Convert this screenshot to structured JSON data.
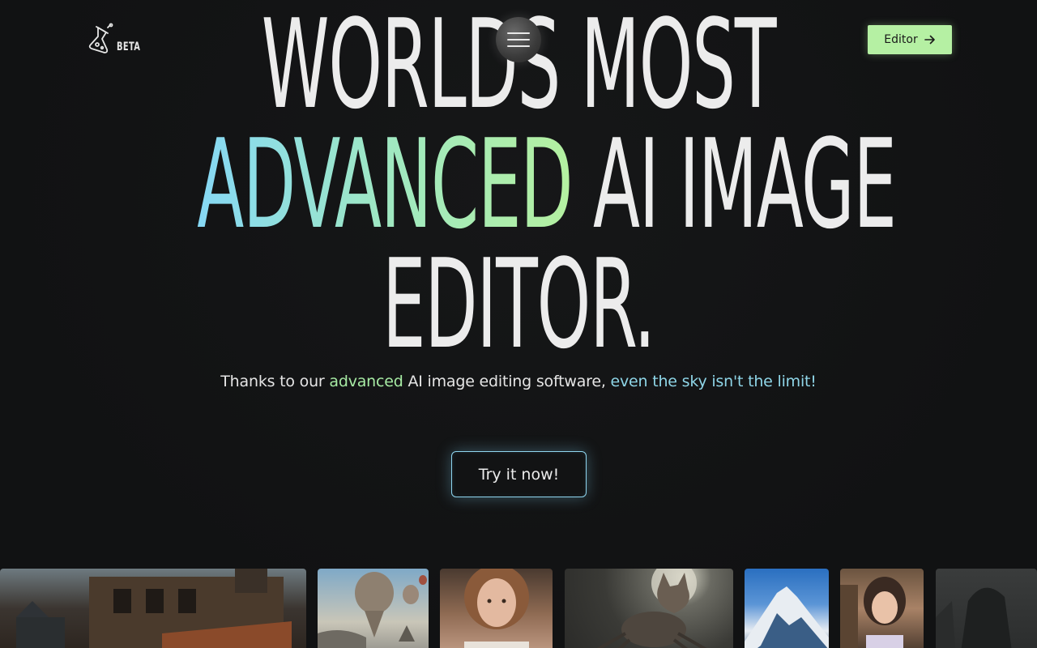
{
  "header": {
    "logo_badge": "BETA",
    "menu_icon": "hamburger-icon",
    "editor_label": "Editor",
    "editor_icon": "arrow-right-icon"
  },
  "hero": {
    "line1": "WORLDS MOST",
    "line2_highlight": "ADVANCED",
    "line2_rest": " AI IMAGE",
    "line3": "EDITOR.",
    "subtitle": {
      "part1": "Thanks to our ",
      "highlight1": "advanced",
      "part2": " AI image editing software, ",
      "highlight2": "even the sky isn't the limit!"
    },
    "cta_label": "Try it now!"
  },
  "colors": {
    "background": "#111213",
    "accent_green": "#b5f0a3",
    "accent_blue": "#86d8f5"
  },
  "gallery": {
    "tiles": [
      "gallery-image-street",
      "gallery-image-balloons",
      "gallery-image-portrait",
      "gallery-image-cat-spider",
      "gallery-image-mountain",
      "gallery-image-anime-girl",
      "gallery-image-dark"
    ]
  }
}
